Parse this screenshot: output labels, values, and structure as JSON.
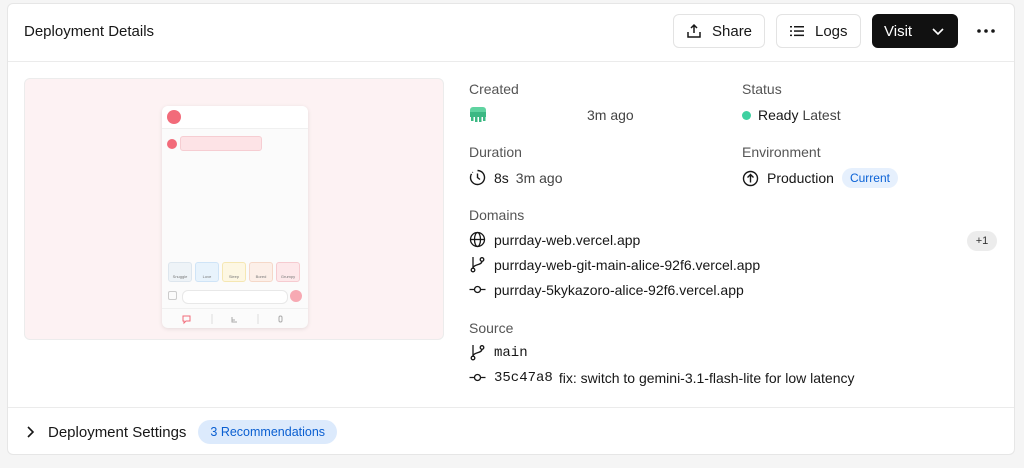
{
  "header": {
    "title": "Deployment Details",
    "share_label": "Share",
    "logs_label": "Logs",
    "visit_label": "Visit"
  },
  "created": {
    "label": "Created",
    "value": "3m ago"
  },
  "status": {
    "label": "Status",
    "value": "Ready",
    "tag": "Latest",
    "color": "#3fd1a1"
  },
  "duration": {
    "label": "Duration",
    "value": "8s",
    "ago": "3m ago"
  },
  "environment": {
    "label": "Environment",
    "value": "Production",
    "badge": "Current"
  },
  "domains": {
    "label": "Domains",
    "items": [
      {
        "text": "purrday-web.vercel.app",
        "icon": "globe-icon"
      },
      {
        "text": "purrday-web-git-main-alice-92f6.vercel.app",
        "icon": "git-branch-icon"
      },
      {
        "text": "purrday-5kykazoro-alice-92f6.vercel.app",
        "icon": "git-commit-icon"
      }
    ],
    "extra_count": "+1"
  },
  "source": {
    "label": "Source",
    "branch": "main",
    "commit_hash": "35c47a8",
    "commit_message": "fix: switch to gemini-3.1-flash-lite for low latency"
  },
  "footer": {
    "settings_label": "Deployment Settings",
    "recommendations": "3 Recommendations"
  },
  "preview": {
    "chips": [
      "Snuggle",
      "Love",
      "Sleep",
      "Bored",
      "Grumpy"
    ]
  }
}
